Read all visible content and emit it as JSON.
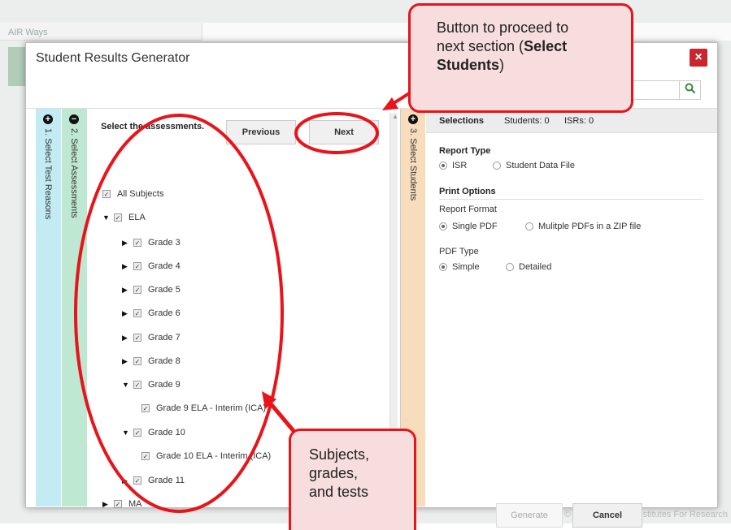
{
  "background": {
    "app_title": "AIR Ways",
    "copyright": "© 2019 American Institutes For Research"
  },
  "modal": {
    "title": "Student Results Generator",
    "close_label": "×",
    "search_icon": "magnifier-icon"
  },
  "steps": {
    "step1": {
      "label": "1. Select Test Reasons",
      "icon": "+"
    },
    "step2": {
      "label": "2. Select Assessments",
      "icon": "−"
    },
    "step3": {
      "label": "3. Select Students",
      "icon": "+"
    }
  },
  "assessments": {
    "heading": "Select the assessments.",
    "previous_label": "Previous",
    "next_label": "Next",
    "tree": [
      {
        "label": "All Subjects",
        "level": 0,
        "toggle": ""
      },
      {
        "label": "ELA",
        "level": 1,
        "toggle": "▼"
      },
      {
        "label": "Grade 3",
        "level": 2,
        "toggle": "▶"
      },
      {
        "label": "Grade 4",
        "level": 2,
        "toggle": "▶"
      },
      {
        "label": "Grade 5",
        "level": 2,
        "toggle": "▶"
      },
      {
        "label": "Grade 6",
        "level": 2,
        "toggle": "▶"
      },
      {
        "label": "Grade 7",
        "level": 2,
        "toggle": "▶"
      },
      {
        "label": "Grade 8",
        "level": 2,
        "toggle": "▶"
      },
      {
        "label": "Grade 9",
        "level": 2,
        "toggle": "▼"
      },
      {
        "label": "Grade 9 ELA - Interim (ICA)",
        "level": 3,
        "toggle": ""
      },
      {
        "label": "Grade 10",
        "level": 2,
        "toggle": "▼"
      },
      {
        "label": "Grade 10 ELA - Interim (ICA)",
        "level": 3,
        "toggle": ""
      },
      {
        "label": "Grade 11",
        "level": 2,
        "toggle": "▶"
      },
      {
        "label": "MA",
        "level": 1,
        "toggle": "▶"
      }
    ]
  },
  "selections": {
    "title": "Selections",
    "students": "Students: 0",
    "isrs": "ISRs: 0",
    "report_type_label": "Report Type",
    "report_type_options": [
      "ISR",
      "Student Data File"
    ],
    "print_options_label": "Print Options",
    "report_format_label": "Report Format",
    "report_format_options": [
      "Single PDF",
      "Mulitple PDFs in a ZIP file"
    ],
    "pdf_type_label": "PDF Type",
    "pdf_type_options": [
      "Simple",
      "Detailed"
    ],
    "generate_label": "Generate",
    "cancel_label": "Cancel"
  },
  "callouts": {
    "next_callout_line1": "Button to proceed to",
    "next_callout_line2": "next section (",
    "next_callout_bold": "Select",
    "next_callout_line3_bold": "Students",
    "next_callout_line3_end": ")",
    "tree_callout_lines": [
      "Subjects,",
      "grades,",
      "and tests"
    ]
  },
  "colors": {
    "annotation_red": "#e8141a",
    "step1_bg": "#c3ebf3",
    "step2_bg": "#bfe8d2",
    "step3_bg": "#f8ddbd",
    "close_red": "#c9252f"
  }
}
